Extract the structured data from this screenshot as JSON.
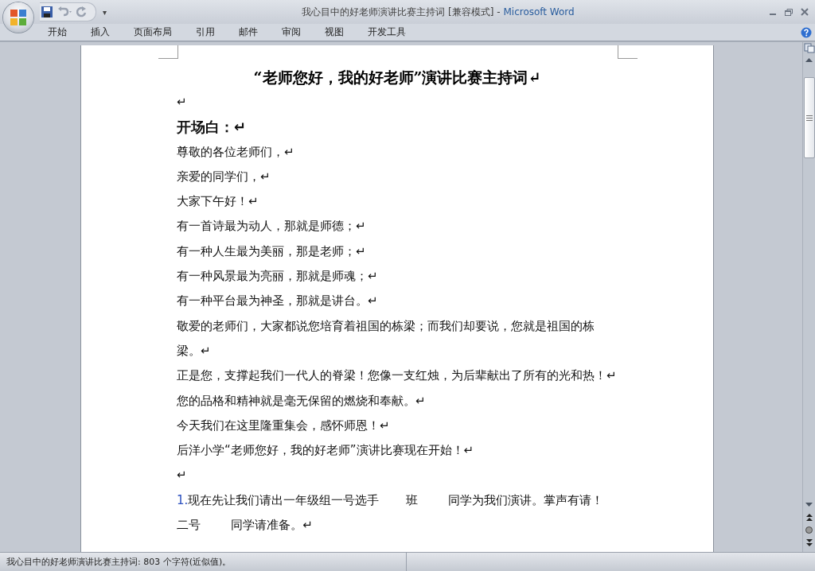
{
  "window": {
    "title": "我心目中的好老师演讲比赛主持词 [兼容模式]",
    "separator": "-",
    "app": "Microsoft Word"
  },
  "quick_access": {
    "customize": "▾"
  },
  "tabs": [
    {
      "label": "开始"
    },
    {
      "label": "插入"
    },
    {
      "label": "页面布局"
    },
    {
      "label": "引用"
    },
    {
      "label": "邮件"
    },
    {
      "label": "审阅"
    },
    {
      "label": "视图"
    },
    {
      "label": "开发工具"
    }
  ],
  "document": {
    "title": "“老师您好，我的好老师”演讲比赛主持词↵",
    "paragraphs": [
      {
        "kind": "text",
        "lines": [
          "↵"
        ]
      },
      {
        "kind": "heading",
        "lines": [
          "开场白：↵"
        ]
      },
      {
        "kind": "text",
        "lines": [
          "尊敬的各位老师们，↵"
        ]
      },
      {
        "kind": "text",
        "lines": [
          "亲爱的同学们，↵"
        ]
      },
      {
        "kind": "text",
        "lines": [
          "大家下午好！↵"
        ]
      },
      {
        "kind": "text",
        "lines": [
          "有一首诗最为动人，那就是师德；↵"
        ]
      },
      {
        "kind": "text",
        "lines": [
          "有一种人生最为美丽，那是老师；↵"
        ]
      },
      {
        "kind": "text",
        "lines": [
          "有一种风景最为亮丽，那就是师魂；↵"
        ]
      },
      {
        "kind": "text",
        "lines": [
          "有一种平台最为神圣，那就是讲台。↵"
        ]
      },
      {
        "kind": "text",
        "lines": [
          "敬爱的老师们，大家都说您培育着祖国的栋梁；而我们却要说，您就是祖国的栋",
          "梁。↵"
        ]
      },
      {
        "kind": "text",
        "lines": [
          "正是您，支撑起我们一代人的脊梁！您像一支红烛，为后辈献出了所有的光和热！↵",
          "您的品格和精神就是毫无保留的燃烧和奉献。↵"
        ]
      },
      {
        "kind": "text",
        "lines": [
          "今天我们在这里隆重集会，感怀师恩！↵"
        ]
      },
      {
        "kind": "text",
        "lines": [
          "后洋小学“老师您好，我的好老师”演讲比赛现在开始！↵"
        ]
      },
      {
        "kind": "text",
        "lines": [
          "↵"
        ]
      },
      {
        "kind": "numbered",
        "number": "1.",
        "lines": [
          "现在先让我们请出一年级组一号选手       班        同学为我们演讲。掌声有请！",
          "二号        同学请准备。↵"
        ]
      }
    ]
  },
  "status_bar": {
    "text": "我心目中的好老师演讲比赛主持词: 803 个字符(近似值)。"
  }
}
